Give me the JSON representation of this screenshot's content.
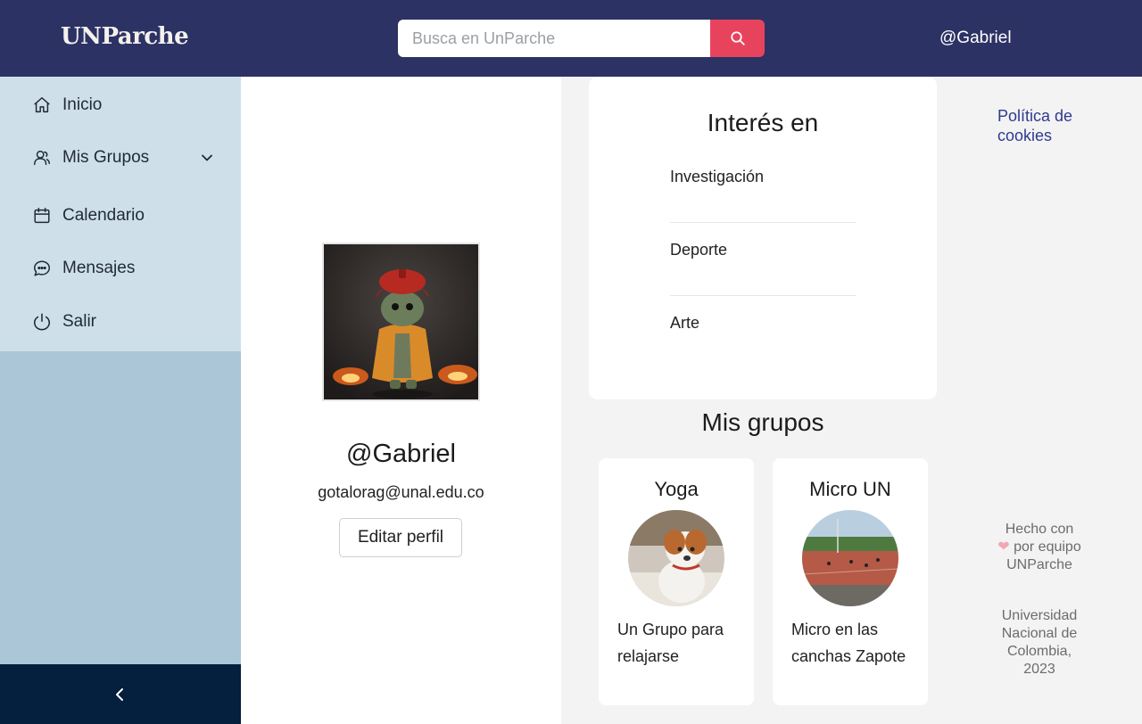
{
  "header": {
    "logo": "UNParche",
    "search_placeholder": "Busca en UnParche",
    "user_handle": "@Gabriel"
  },
  "sidebar": {
    "items": [
      {
        "label": "Inicio",
        "icon": "home-icon"
      },
      {
        "label": "Mis Grupos",
        "icon": "groups-icon"
      },
      {
        "label": "Calendario",
        "icon": "calendar-icon"
      },
      {
        "label": "Mensajes",
        "icon": "messages-icon"
      },
      {
        "label": "Salir",
        "icon": "power-icon"
      }
    ]
  },
  "profile": {
    "username": "@Gabriel",
    "email": "gotalorag@unal.edu.co",
    "edit_label": "Editar perfil"
  },
  "interests": {
    "title": "Interés en",
    "items": [
      "Investigación",
      "Deporte",
      "Arte"
    ]
  },
  "groups": {
    "title": "Mis grupos",
    "items": [
      {
        "name": "Yoga",
        "description": "Un Grupo para relajarse"
      },
      {
        "name": "Micro UN",
        "description": "Micro en las canchas Zapote"
      }
    ]
  },
  "aside": {
    "cookies": "Política de cookies",
    "made_before": "Hecho con",
    "made_after": "por equipo UNParche",
    "university": "Universidad Nacional de Colombia, 2023"
  },
  "colors": {
    "header_bg": "#2c3264",
    "accent": "#e8435d",
    "sidebar_menu_bg": "#cfdfea",
    "sidebar_bg": "#abc6d6",
    "sidebar_footer_bg": "#051f3e"
  }
}
